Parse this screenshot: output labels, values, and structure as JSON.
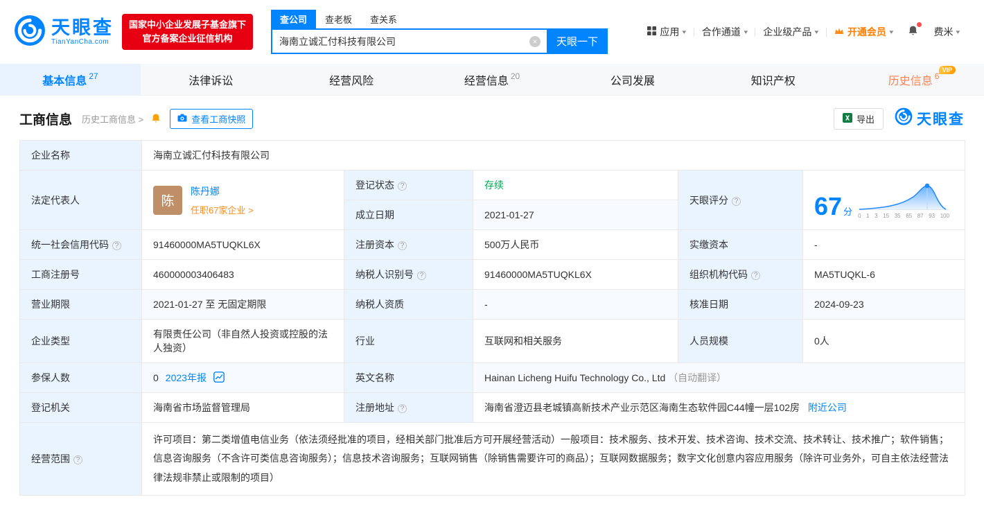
{
  "colors": {
    "brand_blue": "#0084ff",
    "badge_red": "#e60012",
    "status_green": "#00a854",
    "vip_orange": "#ff7e00",
    "history_orange": "#ff8050",
    "label_bg": "#e9f4ff"
  },
  "icons": {
    "caret": "▾",
    "clear": "×",
    "question": "?"
  },
  "header": {
    "logo": {
      "name": "天眼查",
      "domain": "TianYanCha.com"
    },
    "badge": {
      "line1": "国家中小企业发展子基金旗下",
      "line2": "官方备案企业征信机构"
    },
    "search": {
      "tabs": [
        {
          "label": "查公司"
        },
        {
          "label": "查老板"
        },
        {
          "label": "查关系"
        }
      ],
      "value": "海南立诚汇付科技有限公司",
      "button": "天眼一下"
    },
    "nav": {
      "apps": "应用",
      "partner": "合作通道",
      "enterprise": "企业级产品",
      "vip": "开通会员",
      "user": "费米"
    }
  },
  "tabs": {
    "items": [
      {
        "label": "基本信息",
        "count": "27"
      },
      {
        "label": "法律诉讼"
      },
      {
        "label": "经营风险"
      },
      {
        "label": "经营信息",
        "count": "20"
      },
      {
        "label": "公司发展"
      },
      {
        "label": "知识产权"
      },
      {
        "label": "历史信息",
        "count": "6",
        "vip_tag": "VIP"
      }
    ]
  },
  "section": {
    "title": "工商信息",
    "history_link": "历史工商信息 >",
    "snapshot_button": "查看工商快照",
    "export_button": "导出",
    "brand": "天眼查"
  },
  "table": {
    "company_name": {
      "label": "企业名称",
      "value": "海南立诚汇付科技有限公司"
    },
    "legal_rep": {
      "label": "法定代表人",
      "avatar": "陈",
      "name": "陈丹娜",
      "positions": "任职67家企业 >"
    },
    "reg_status": {
      "label": "登记状态",
      "value": "存续"
    },
    "est_date": {
      "label": "成立日期",
      "value": "2021-01-27"
    },
    "score": {
      "label": "天眼评分",
      "value": "67",
      "unit": "分",
      "ticks": [
        "0",
        "1",
        "3",
        "15",
        "35",
        "65",
        "87",
        "93",
        "100"
      ]
    },
    "credit_code": {
      "label": "统一社会信用代码",
      "value": "91460000MA5TUQKL6X"
    },
    "reg_capital": {
      "label": "注册资本",
      "value": "500万人民币"
    },
    "paid_capital": {
      "label": "实缴资本",
      "value": "-"
    },
    "reg_number": {
      "label": "工商注册号",
      "value": "460000003406483"
    },
    "taxpayer_id": {
      "label": "纳税人识别号",
      "value": "91460000MA5TUQKL6X"
    },
    "org_code": {
      "label": "组织机构代码",
      "value": "MA5TUQKL-6"
    },
    "business_term": {
      "label": "营业期限",
      "value": "2021-01-27 至 无固定期限"
    },
    "taxpayer_quality": {
      "label": "纳税人资质",
      "value": "-"
    },
    "approval_date": {
      "label": "核准日期",
      "value": "2024-09-23"
    },
    "company_type": {
      "label": "企业类型",
      "value": "有限责任公司（非自然人投资或控股的法人独资）"
    },
    "industry": {
      "label": "行业",
      "value": "互联网和相关服务"
    },
    "staff_size": {
      "label": "人员规模",
      "value": "0人"
    },
    "insured": {
      "label": "参保人数",
      "value": "0",
      "report": "2023年报"
    },
    "english_name": {
      "label": "英文名称",
      "value": "Hainan Licheng Huifu Technology Co., Ltd",
      "note": "（自动翻译）"
    },
    "reg_authority": {
      "label": "登记机关",
      "value": "海南省市场监督管理局"
    },
    "reg_address": {
      "label": "注册地址",
      "value": "海南省澄迈县老城镇高新技术产业示范区海南生态软件园C44幢一层102房",
      "nearby": "附近公司"
    },
    "business_scope": {
      "label": "经营范围",
      "value": "许可项目：第二类增值电信业务（依法须经批准的项目，经相关部门批准后方可开展经营活动）一般项目：技术服务、技术开发、技术咨询、技术交流、技术转让、技术推广；软件销售；信息咨询服务（不含许可类信息咨询服务）；信息技术咨询服务；互联网销售（除销售需要许可的商品）；互联网数据服务；数字文化创意内容应用服务（除许可业务外，可自主依法经营法律法规非禁止或限制的项目）"
    }
  }
}
